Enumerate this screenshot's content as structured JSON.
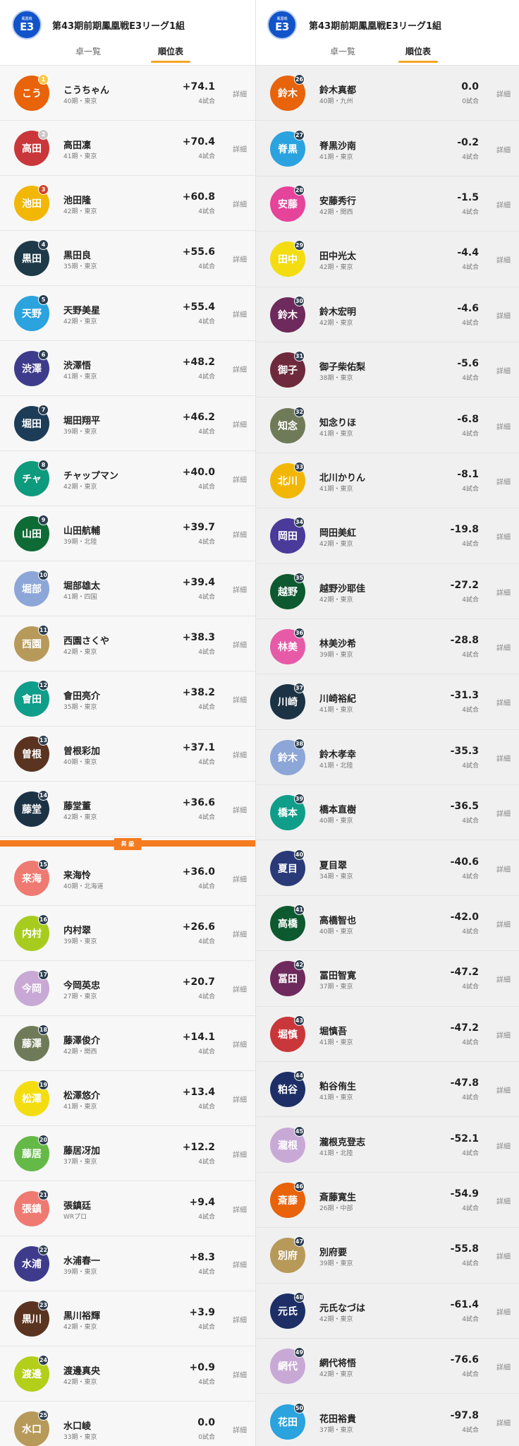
{
  "left": {
    "logo": {
      "top": "鳳凰戦",
      "big": "E3"
    },
    "title": "第43期前期鳳凰戦E3リーグ1組",
    "tabs": [
      "卓一覧",
      "順位表"
    ],
    "active_tab": 1,
    "players": [
      {
        "rank": "1",
        "name": "こうちゃん",
        "meta": "40期・東京",
        "score": "+74.1",
        "games": "4試合",
        "abbr": "こう",
        "color": "#e8630a"
      },
      {
        "rank": "2",
        "name": "高田凜",
        "meta": "41期・東京",
        "score": "+70.4",
        "games": "4試合",
        "abbr": "高田",
        "color": "#c9373b"
      },
      {
        "rank": "3",
        "name": "池田隆",
        "meta": "42期・東京",
        "score": "+60.8",
        "games": "4試合",
        "abbr": "池田",
        "color": "#f2b705"
      },
      {
        "rank": "4",
        "name": "黒田良",
        "meta": "35期・東京",
        "score": "+55.6",
        "games": "4試合",
        "abbr": "黒田",
        "color": "#1e3a48"
      },
      {
        "rank": "5",
        "name": "天野美星",
        "meta": "42期・東京",
        "score": "+55.4",
        "games": "4試合",
        "abbr": "天野",
        "color": "#2aa3df"
      },
      {
        "rank": "6",
        "name": "渋澤悟",
        "meta": "41期・東京",
        "score": "+48.2",
        "games": "4試合",
        "abbr": "渋澤",
        "color": "#3f3b8c"
      },
      {
        "rank": "7",
        "name": "堀田翔平",
        "meta": "39期・東京",
        "score": "+46.2",
        "games": "4試合",
        "abbr": "堀田",
        "color": "#1d3c58"
      },
      {
        "rank": "8",
        "name": "チャップマン",
        "meta": "42期・東京",
        "score": "+40.0",
        "games": "4試合",
        "abbr": "チャ",
        "color": "#0e9a7c"
      },
      {
        "rank": "9",
        "name": "山田航輔",
        "meta": "39期・北陸",
        "score": "+39.7",
        "games": "4試合",
        "abbr": "山田",
        "color": "#0e6b35"
      },
      {
        "rank": "10",
        "name": "堀部雄太",
        "meta": "41期・四国",
        "score": "+39.4",
        "games": "4試合",
        "abbr": "堀部",
        "color": "#8ca6d8"
      },
      {
        "rank": "11",
        "name": "西園さくや",
        "meta": "42期・東京",
        "score": "+38.3",
        "games": "4試合",
        "abbr": "西園",
        "color": "#b79a5a"
      },
      {
        "rank": "12",
        "name": "會田亮介",
        "meta": "35期・東京",
        "score": "+38.2",
        "games": "4試合",
        "abbr": "會田",
        "color": "#0f9e8a"
      },
      {
        "rank": "13",
        "name": "曽根彩加",
        "meta": "40期・東京",
        "score": "+37.1",
        "games": "4試合",
        "abbr": "曽根",
        "color": "#5a3420"
      },
      {
        "rank": "14",
        "name": "藤堂董",
        "meta": "42期・東京",
        "score": "+36.6",
        "games": "4試合",
        "abbr": "藤堂",
        "color": "#1c3346"
      },
      {
        "rank": "15",
        "name": "来海怜",
        "meta": "40期・北海道",
        "score": "+36.0",
        "games": "4試合",
        "abbr": "来海",
        "color": "#ef7a72"
      },
      {
        "rank": "16",
        "name": "内村翠",
        "meta": "39期・東京",
        "score": "+26.6",
        "games": "4試合",
        "abbr": "内村",
        "color": "#a8cc1e"
      },
      {
        "rank": "17",
        "name": "今岡英忠",
        "meta": "27期・東京",
        "score": "+20.7",
        "games": "4試合",
        "abbr": "今岡",
        "color": "#c8a9d6"
      },
      {
        "rank": "18",
        "name": "藤澤俊介",
        "meta": "42期・関西",
        "score": "+14.1",
        "games": "4試合",
        "abbr": "藤澤",
        "color": "#6f7b58"
      },
      {
        "rank": "19",
        "name": "松澤悠介",
        "meta": "41期・東京",
        "score": "+13.4",
        "games": "4試合",
        "abbr": "松澤",
        "color": "#f3dd10"
      },
      {
        "rank": "20",
        "name": "藤居冴加",
        "meta": "37期・東京",
        "score": "+12.2",
        "games": "4試合",
        "abbr": "藤居",
        "color": "#64b947"
      },
      {
        "rank": "21",
        "name": "張鎮廷",
        "meta": "WRプロ",
        "score": "+9.4",
        "games": "4試合",
        "abbr": "張鎮",
        "color": "#ef7a72"
      },
      {
        "rank": "22",
        "name": "水浦春一",
        "meta": "39期・東京",
        "score": "+8.3",
        "games": "4試合",
        "abbr": "水浦",
        "color": "#3f3b8c"
      },
      {
        "rank": "23",
        "name": "黒川裕輝",
        "meta": "42期・東京",
        "score": "+3.9",
        "games": "4試合",
        "abbr": "黒川",
        "color": "#5a3420"
      },
      {
        "rank": "24",
        "name": "渡邊真央",
        "meta": "42期・東京",
        "score": "+0.9",
        "games": "4試合",
        "abbr": "渡邊",
        "color": "#b3cf1a"
      },
      {
        "rank": "25",
        "name": "水口崚",
        "meta": "33期・東京",
        "score": "0.0",
        "games": "0試合",
        "abbr": "水口",
        "color": "#b79a5a"
      }
    ],
    "divider_label": "昇 級"
  },
  "right": {
    "logo": {
      "top": "鳳凰戦",
      "big": "E3"
    },
    "title": "第43期前期鳳凰戦E3リーグ1組",
    "tabs": [
      "卓一覧",
      "順位表"
    ],
    "active_tab": 1,
    "players": [
      {
        "rank": "26",
        "name": "鈴木真都",
        "meta": "40期・九州",
        "score": "0.0",
        "games": "0試合",
        "abbr": "鈴木",
        "color": "#e8630a"
      },
      {
        "rank": "27",
        "name": "脊黒沙南",
        "meta": "41期・東京",
        "score": "-0.2",
        "games": "4試合",
        "abbr": "脊黒",
        "color": "#2aa3df"
      },
      {
        "rank": "28",
        "name": "安藤秀行",
        "meta": "42期・関西",
        "score": "-1.5",
        "games": "4試合",
        "abbr": "安藤",
        "color": "#e6439a"
      },
      {
        "rank": "29",
        "name": "田中光太",
        "meta": "42期・東京",
        "score": "-4.4",
        "games": "4試合",
        "abbr": "田中",
        "color": "#f3dd10"
      },
      {
        "rank": "30",
        "name": "鈴木宏明",
        "meta": "42期・東京",
        "score": "-4.6",
        "games": "4試合",
        "abbr": "鈴木",
        "color": "#6e2a5c"
      },
      {
        "rank": "31",
        "name": "御子柴佑梨",
        "meta": "38期・東京",
        "score": "-5.6",
        "games": "4試合",
        "abbr": "御子",
        "color": "#6e2a3c"
      },
      {
        "rank": "32",
        "name": "知念りほ",
        "meta": "41期・東京",
        "score": "-6.8",
        "games": "4試合",
        "abbr": "知念",
        "color": "#6f7b58"
      },
      {
        "rank": "33",
        "name": "北川かりん",
        "meta": "41期・東京",
        "score": "-8.1",
        "games": "4試合",
        "abbr": "北川",
        "color": "#f2b705"
      },
      {
        "rank": "34",
        "name": "岡田美紅",
        "meta": "42期・東京",
        "score": "-19.8",
        "games": "4試合",
        "abbr": "岡田",
        "color": "#4a3a9a"
      },
      {
        "rank": "35",
        "name": "越野沙耶佳",
        "meta": "42期・東京",
        "score": "-27.2",
        "games": "4試合",
        "abbr": "越野",
        "color": "#0e5a30"
      },
      {
        "rank": "36",
        "name": "林美沙希",
        "meta": "39期・東京",
        "score": "-28.8",
        "games": "4試合",
        "abbr": "林美",
        "color": "#e65aa8"
      },
      {
        "rank": "37",
        "name": "川崎裕紀",
        "meta": "41期・東京",
        "score": "-31.3",
        "games": "4試合",
        "abbr": "川崎",
        "color": "#1c3346"
      },
      {
        "rank": "38",
        "name": "鈴木孝幸",
        "meta": "41期・北陸",
        "score": "-35.3",
        "games": "4試合",
        "abbr": "鈴木",
        "color": "#8ca6d8"
      },
      {
        "rank": "39",
        "name": "橋本直樹",
        "meta": "40期・東京",
        "score": "-36.5",
        "games": "4試合",
        "abbr": "橋本",
        "color": "#0f9e8a"
      },
      {
        "rank": "40",
        "name": "夏目翠",
        "meta": "34期・東京",
        "score": "-40.6",
        "games": "4試合",
        "abbr": "夏目",
        "color": "#2a3a78"
      },
      {
        "rank": "41",
        "name": "高橋智也",
        "meta": "40期・東京",
        "score": "-42.0",
        "games": "4試合",
        "abbr": "高橋",
        "color": "#0e5a30"
      },
      {
        "rank": "42",
        "name": "冨田智寛",
        "meta": "37期・東京",
        "score": "-47.2",
        "games": "4試合",
        "abbr": "冨田",
        "color": "#6e2a5c"
      },
      {
        "rank": "43",
        "name": "堀慎吾",
        "meta": "41期・東京",
        "score": "-47.2",
        "games": "4試合",
        "abbr": "堀慎",
        "color": "#c9373b"
      },
      {
        "rank": "44",
        "name": "粕谷侑生",
        "meta": "41期・東京",
        "score": "-47.8",
        "games": "4試合",
        "abbr": "粕谷",
        "color": "#1d2f66"
      },
      {
        "rank": "45",
        "name": "瀧根克登志",
        "meta": "41期・北陸",
        "score": "-52.1",
        "games": "4試合",
        "abbr": "瀧根",
        "color": "#c8a9d6"
      },
      {
        "rank": "46",
        "name": "斎藤寛生",
        "meta": "26期・中部",
        "score": "-54.9",
        "games": "4試合",
        "abbr": "斎藤",
        "color": "#e8630a"
      },
      {
        "rank": "47",
        "name": "別府要",
        "meta": "39期・東京",
        "score": "-55.8",
        "games": "4試合",
        "abbr": "別府",
        "color": "#b79a5a"
      },
      {
        "rank": "48",
        "name": "元氏なづは",
        "meta": "42期・東京",
        "score": "-61.4",
        "games": "4試合",
        "abbr": "元氏",
        "color": "#1d2f66"
      },
      {
        "rank": "49",
        "name": "網代将悟",
        "meta": "42期・東京",
        "score": "-76.6",
        "games": "4試合",
        "abbr": "網代",
        "color": "#c8a9d6"
      },
      {
        "rank": "50",
        "name": "花田裕貴",
        "meta": "37期・東京",
        "score": "-97.8",
        "games": "4試合",
        "abbr": "花田",
        "color": "#2aa3df"
      }
    ]
  },
  "detail_label": "詳細",
  "badge_colors": {
    "top1": "#f7c948",
    "top2": "#c8c8c8",
    "top3": "#d0452c",
    "default": "#2c3e50"
  }
}
